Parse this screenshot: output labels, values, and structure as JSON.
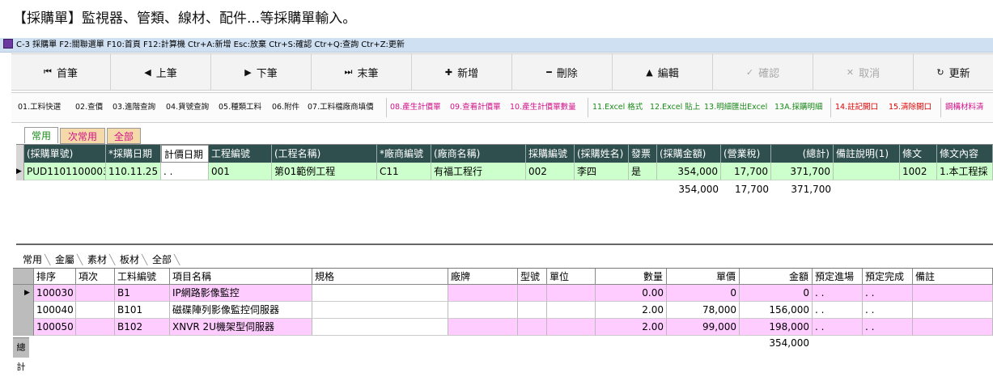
{
  "heading": "【採購單】監視器、管類、線材、配件...等採購單輸入。",
  "titlebar": "C-3 採購單   F2:關聯選單  F10:首頁  F12:計算機  Ctr+A:新增  Esc:放棄  Ctr+S:確認  Ctr+Q:查詢  Ctr+Z:更新",
  "nav": [
    {
      "icon": "⏮",
      "label": "首筆"
    },
    {
      "icon": "◀",
      "label": "上筆"
    },
    {
      "icon": "▶",
      "label": "下筆"
    },
    {
      "icon": "⏭",
      "label": "末筆"
    },
    {
      "icon": "✚",
      "label": "新增"
    },
    {
      "icon": "━",
      "label": "刪除"
    },
    {
      "icon": "▲",
      "label": "編輯"
    },
    {
      "icon": "✓",
      "label": "確認"
    },
    {
      "icon": "✕",
      "label": "取消"
    },
    {
      "icon": "↻",
      "label": "更新"
    }
  ],
  "functions": {
    "f1": "01.工料快選",
    "f2": "02.查價",
    "f3": "03.進階查詢",
    "f4": "04.貨號查詢",
    "f5": "05.種類工料",
    "f6": "06.附件",
    "f7": "07.工料檔廠商填價",
    "f8": "08.產生計價單",
    "f9": "09.查看計價單",
    "f10": "10.產生計價單數量",
    "f11": "11.Excel 格式",
    "f12": "12.Excel 貼上",
    "f13": "13.明細匯出Excel",
    "f13a": "13A.採購明細",
    "f14": "14.註記開口",
    "f15": "15.清除開口",
    "f16": "鋼構材料清"
  },
  "tabs": {
    "common": "常用",
    "sub": "次常用",
    "all": "全部"
  },
  "grid1": {
    "headers": [
      "(採購單號)",
      "*採購日期",
      "計價日期",
      "工程編號",
      "(工程名稱)",
      "*廠商編號",
      "(廠商名稱)",
      "採購編號",
      "(採購姓名)",
      "發票",
      "(採購金額)",
      "(營業稅)",
      "(總計)",
      "備註說明(1)",
      "條文",
      "條文內容"
    ],
    "row": [
      "PUD1101100003",
      "110.11.25",
      ". .",
      "001",
      "第01範例工程",
      "C11",
      "有福工程行",
      "002",
      "李四",
      "是",
      "354,000",
      "17,700",
      "371,700",
      "",
      "1002",
      "1.本工程採"
    ],
    "totals": {
      "amount": "354,000",
      "tax": "17,700",
      "total": "371,700"
    }
  },
  "subtabs": [
    "常用",
    "金屬",
    "素材",
    "板材",
    "全部"
  ],
  "grid2": {
    "headers": [
      "排序",
      "項次",
      "工料編號",
      "項目名稱",
      "規格",
      "廠牌",
      "型號",
      "單位",
      "數量",
      "單價",
      "金額",
      "預定進場",
      "預定完成",
      "備註"
    ],
    "rows": [
      [
        "100030",
        "",
        "B1",
        "IP網路影像監控",
        "",
        "",
        "",
        "",
        "0.00",
        "0",
        "0",
        ". .",
        ". .",
        ""
      ],
      [
        "100040",
        "",
        "B101",
        "磁碟陣列影像監控伺服器",
        "",
        "",
        "",
        "",
        "2.00",
        "78,000",
        "156,000",
        ". .",
        ". .",
        ""
      ],
      [
        "100050",
        "",
        "B102",
        "XNVR 2U機架型伺服器",
        "",
        "",
        "",
        "",
        "2.00",
        "99,000",
        "198,000",
        ". .",
        ". .",
        ""
      ]
    ],
    "total_label": "總計",
    "total_amount": "354,000"
  },
  "colors": {
    "header_dark": "#2f4f4f",
    "row_green": "#ccffcc",
    "row_pink": "#ffccff",
    "tab_orange": "#f6d9a8"
  }
}
